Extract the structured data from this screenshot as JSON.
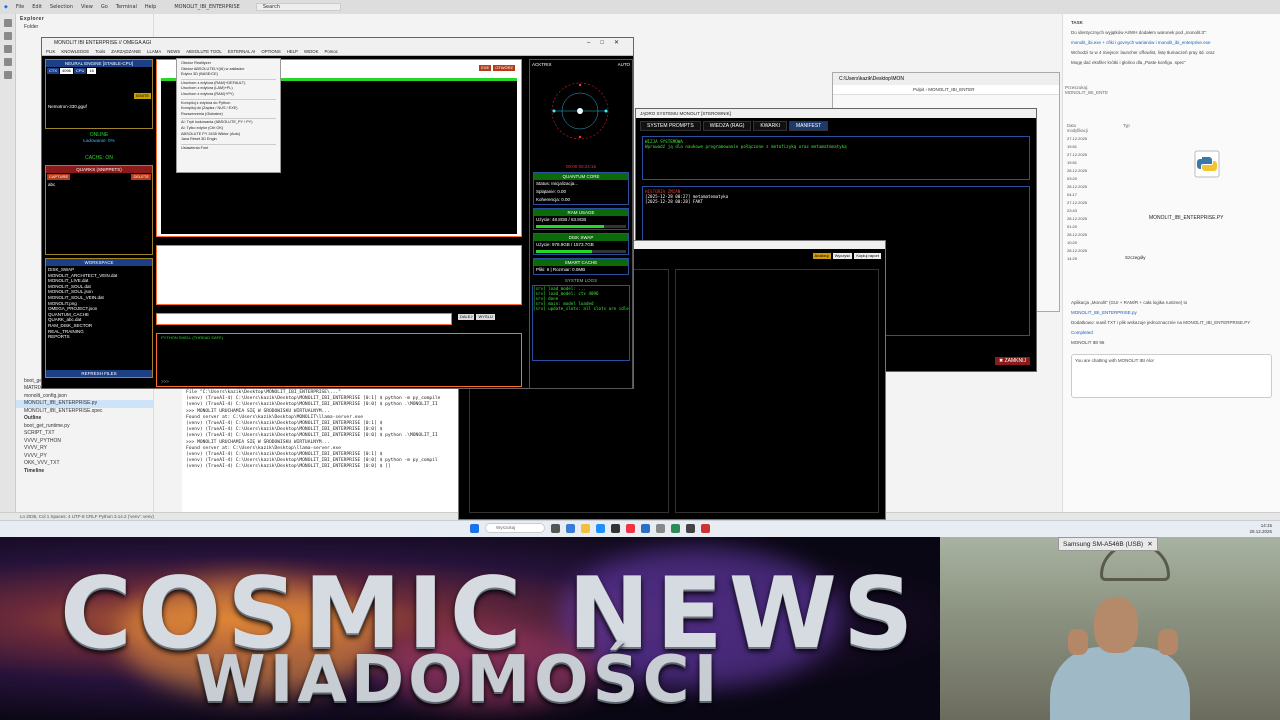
{
  "vscode": {
    "menu": [
      "File",
      "Edit",
      "Selection",
      "View",
      "Go",
      "Terminal",
      "Help"
    ],
    "title": "MONOLIT_IBI_ENTERPRISE",
    "search_placeholder": "Search",
    "explorer_label": "Explorer",
    "folder_label": "Folder",
    "files": [
      "boot_get_runtime.py",
      "MATRIX.PLUS MATRIX.A NINUS MATRIX.B",
      "monolit_config.json",
      "MONOLIT_IBI_ENTERPRISE.py",
      "MONOLIT_IBI_ENTERPRISE.spec"
    ],
    "outline_label": "Outline",
    "outline_items": [
      "boot_get_runtime.py",
      "SCRIPT_TXT",
      "VVVV_PYTHON",
      "VVVV_RY",
      "VVVV_PY",
      "OKK_VVV_TXT"
    ],
    "timeline_label": "Timeline",
    "status_text": "Ln 2036, Col 1   Spaces: 4   UTF-8   CRLF   Python   3.14.2 ('venv': venv)"
  },
  "terminal": {
    "lines": [
      "  File \"C:\\Users\\kazik\\Desktop\\MONOLIT_IBI_ENTERPRISE\\...\"",
      "(venv) (TrueAI-4) C:\\Users\\kazik\\Desktop\\MONOLIT_IBI_ENTERPRISE [0:1] $ python -m py_compile",
      "(venv) (TrueAI-4) C:\\Users\\kazik\\Desktop\\MONOLIT_IBI_ENTERPRISE [0:0] $ python .\\MONOLIT_II",
      ">>> MONOLIT URUCHAMIA SIĘ W ŚRODOWISKU WIRTUALNYM...",
      "Found server at: C:\\Users\\kazik\\Desktop\\MONOLIT\\llama-server.exe",
      "(venv) (TrueAI-4) C:\\Users\\kazik\\Desktop\\MONOLIT_IBI_ENTERPRISE [0:1] $",
      "(venv) (TrueAI-4) C:\\Users\\kazik\\Desktop\\MONOLIT_IBI_ENTERPRISE [0:0] $",
      "(venv) (TrueAI-4) C:\\Users\\kazik\\Desktop\\MONOLIT_IBI_ENTERPRISE [0:0] $ python .\\MONOLIT_II",
      ">>> MONOLIT URUCHAMIA SIĘ W ŚRODOWISKU WIRTUALNYM...",
      "Found server at: C:\\Users\\kazik\\Desktop\\llama-server.exe",
      "(venv) (TrueAI-4) C:\\Users\\kazik\\Desktop\\MONOLIT_IBI_ENTERPRISE [0:1] $",
      "(venv) (TrueAI-4) C:\\Users\\kazik\\Desktop\\MONOLIT_IBI_ENTERPRISE [0:0] $ python -m py_compil",
      "(venv) (TrueAI-4) C:\\Users\\kazik\\Desktop\\MONOLIT_IBI_ENTERPRISE [0:0] $ []"
    ]
  },
  "chat": {
    "title": "TASK",
    "paragraphs": [
      "Do identycznych wyjątków AI/WH dodałem warunek pod „monolit.tt”:",
      "monolit_ibi.exe + cfiki i govnych warianów i monolit_ibi_enterprise.exe",
      "Wchodzi to w 4 miejsce: launcher offowlist, listę tłumaczeń pray itd. oraz",
      "Mogę dać eksfiler krótki i głośno dla „Paste konfigu .spec”",
      "Aplikacja „Monolit” (GUI + RAM/R + cała logika runtime) to",
      "MONOLIT_IBI_ENTERPRISE.py",
      "Dodatkowo: suwil.TXT i plik wskazuje jednoznacznie na MONOLIT_IBI_ENTERPRISE.PY"
    ],
    "completed_label": "Completed",
    "model_label": "MONOLIT IBI 96",
    "input_placeholder": "You are chatting with MONOLIT IBI Alor"
  },
  "monolit": {
    "title": "MONOLIT IBI ENTERPRISE // OMEGA AGI",
    "menu": [
      "PLIK",
      "KNOWLEDGE",
      "Tools",
      "ZARZĄDZANIE",
      "LLAMA",
      "NEWS",
      "ABSOLUTE TOOL",
      "EXTERNAL AI",
      "OPTIONS",
      "HELP",
      "WIDOK",
      "Pomoc"
    ],
    "engine_title": "NEURAL ENGINE [STABLE-CPU]",
    "engine_tabs": [
      "CTX",
      "4096",
      "CPU",
      "16"
    ],
    "ignite_label": "IGNITE",
    "model_file": "Nemotron-330.gguf",
    "online_label": "ONLINE",
    "loading_label": "Ładowanie: 0%",
    "cache_label": "CACHE: ON",
    "quarks_title": "QUARKS (SNIPPETS)",
    "capture_label": "CAPTURE",
    "delete_label": "DELETE",
    "quark_item": "abc",
    "workspace_title": "WORKSPACE",
    "workspace_files": [
      "DISK_SWAP",
      "MONOLIT_ARCHITECT_VEIN.dat",
      "MONOLIT_LIVE.dat",
      "MONOLIT_SOUL.dat",
      "MONOLIT_SOUL.json",
      "MONOLIT_SOUL_VEIN.dat",
      "MONOLIT.png",
      "OMEGA_PROJECT.json",
      "QUANTUM_CACHE",
      "QUARK_abc.dat",
      "RAM_DISK_SECTOR",
      "REAL_TRAINING",
      "REPORTS"
    ],
    "refresh_label": "REFRESH FILES",
    "dropdown_items": [
      "Otwórz Realityzer",
      "Otwórz ABSOLUTELY(AI) w zakładce",
      "Edytor 3D (BASE/CE)",
      "Uruchom z edytora (RAM)+DEFAULT)",
      "Uruchom z edytora (LAM)+PL)",
      "Uruchom z edytora (RAM)+PY)",
      "Kompiluj z edytora do Python",
      "Kompiluj do (Zapisz / NUS / EXE)",
      "Rozszerzenia (Globalne)",
      "AI: Tryb kodowania (ABSOLUTE_PY / PY)",
      "AI: Tylko edytor (Ctrl OK)",
      "ABSOLUTE PY 3435 Wiktor (Auto)",
      "Java Reset 3D Engin",
      "Ustawienia Font"
    ],
    "editor_buttons": [
      "EXE",
      "OTWÓRZ"
    ],
    "send_buttons": [
      "DALEJ",
      "WYŚLIJ"
    ],
    "python_shell_label": "PYTHON SHELL (THREAD SAFE)",
    "shell_prompt": ">>>",
    "right": {
      "actrix_label": "ACKTRIX",
      "auto_label": "AUTO",
      "timer": "00:00 00:24:16",
      "quantum_title": "QUANTUM CORE",
      "status_line": "Status: Inicjalizacja...",
      "entangle_line": "Splątanie: 0.00",
      "coherence_line": "Koherencja: 0.00",
      "ram_title": "RAM USAGE",
      "ram_line": "Użycie: 48.8GB / 63.9GB",
      "ram_fraction": 0.76,
      "disk_title": "DISK SWAP",
      "disk_line": "Użycie: 978.9GB / 1573.7GB",
      "disk_fraction": 0.62,
      "cache_title": "SMART CACHE",
      "cache_line": "Pliki: 6 | Rozmiar: 0.0MB",
      "logs_title": "SYSTEM LOGS",
      "log_lines": [
        "[srv] load_model: ...",
        "[srv] load_model: ctx 4096",
        "[srv] done",
        "[srv] main: model loaded",
        "[srv] update_slots: all slots are idle"
      ]
    }
  },
  "file_explorer": {
    "title": "C:\\Users\\kazik\\Desktop\\MON",
    "path_items": [
      "Pulpit",
      "MONOLIT_IBI_ENTER"
    ],
    "search_placeholder": "Przeszukaj: MONOLIT_IBI_ENTE",
    "column_date": "Data modyfikacji",
    "column_type": "Typ",
    "details_label": "Szczegóły",
    "selected_file": "MONOLIT_IBI_ENTERPRISE.PY",
    "rows": [
      "27.12.2025 19:51",
      "27.12.2025 19:51",
      "28.12.2025 03:20",
      "28.12.2025 04:17",
      "27.12.2025 23:43",
      "28.12.2025 01:20",
      "28.12.2025 10:20",
      "28.12.2025 14:29"
    ]
  },
  "manifest": {
    "title": "JĄDRO SYSTEMU MONOLIT [STEROWNIK]",
    "tabs": [
      "SYSTEM PROMPTS",
      "WIEDZA (RAG)",
      "KWARKI",
      "MANIFEST"
    ],
    "header": "WIZJA SYSTEMOWA",
    "body": "Wprowadź ją dla naukowe programowanie połączone z metafizyką oraz metamatematyką",
    "history_label": "HISTORIA ZMIAN",
    "history_lines": [
      "[2025-12-28 00:27] metamatematyka",
      "[2025-12-28 00:28] FAKT"
    ],
    "close_label": "ZAMKNIJ"
  },
  "analyze": {
    "buttons": [
      "Analizuj",
      "Wyczyść",
      "Kopiuj raport"
    ]
  },
  "taskbar": {
    "search_placeholder": "Wyszukaj",
    "clock_time": "14:15",
    "clock_date": "28.12.2025"
  },
  "banner": {
    "title": "COSMIC NEWS",
    "subtitle": "WIADOMOŚCI"
  },
  "webcam": {
    "label": "Samsung SM-A546B (USB)"
  }
}
